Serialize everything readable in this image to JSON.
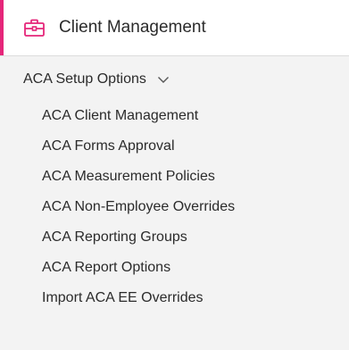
{
  "header": {
    "title": "Client Management",
    "icon": "briefcase-icon",
    "accent_color": "#e5267a"
  },
  "group": {
    "label": "ACA Setup Options",
    "expanded": true,
    "chevron_icon": "chevron-down-icon"
  },
  "menu": {
    "items": [
      {
        "label": "ACA Client Management"
      },
      {
        "label": "ACA Forms Approval"
      },
      {
        "label": "ACA Measurement Policies"
      },
      {
        "label": "ACA Non-Employee Overrides"
      },
      {
        "label": "ACA Reporting Groups"
      },
      {
        "label": "ACA Report Options"
      },
      {
        "label": "Import ACA EE Overrides"
      }
    ]
  }
}
